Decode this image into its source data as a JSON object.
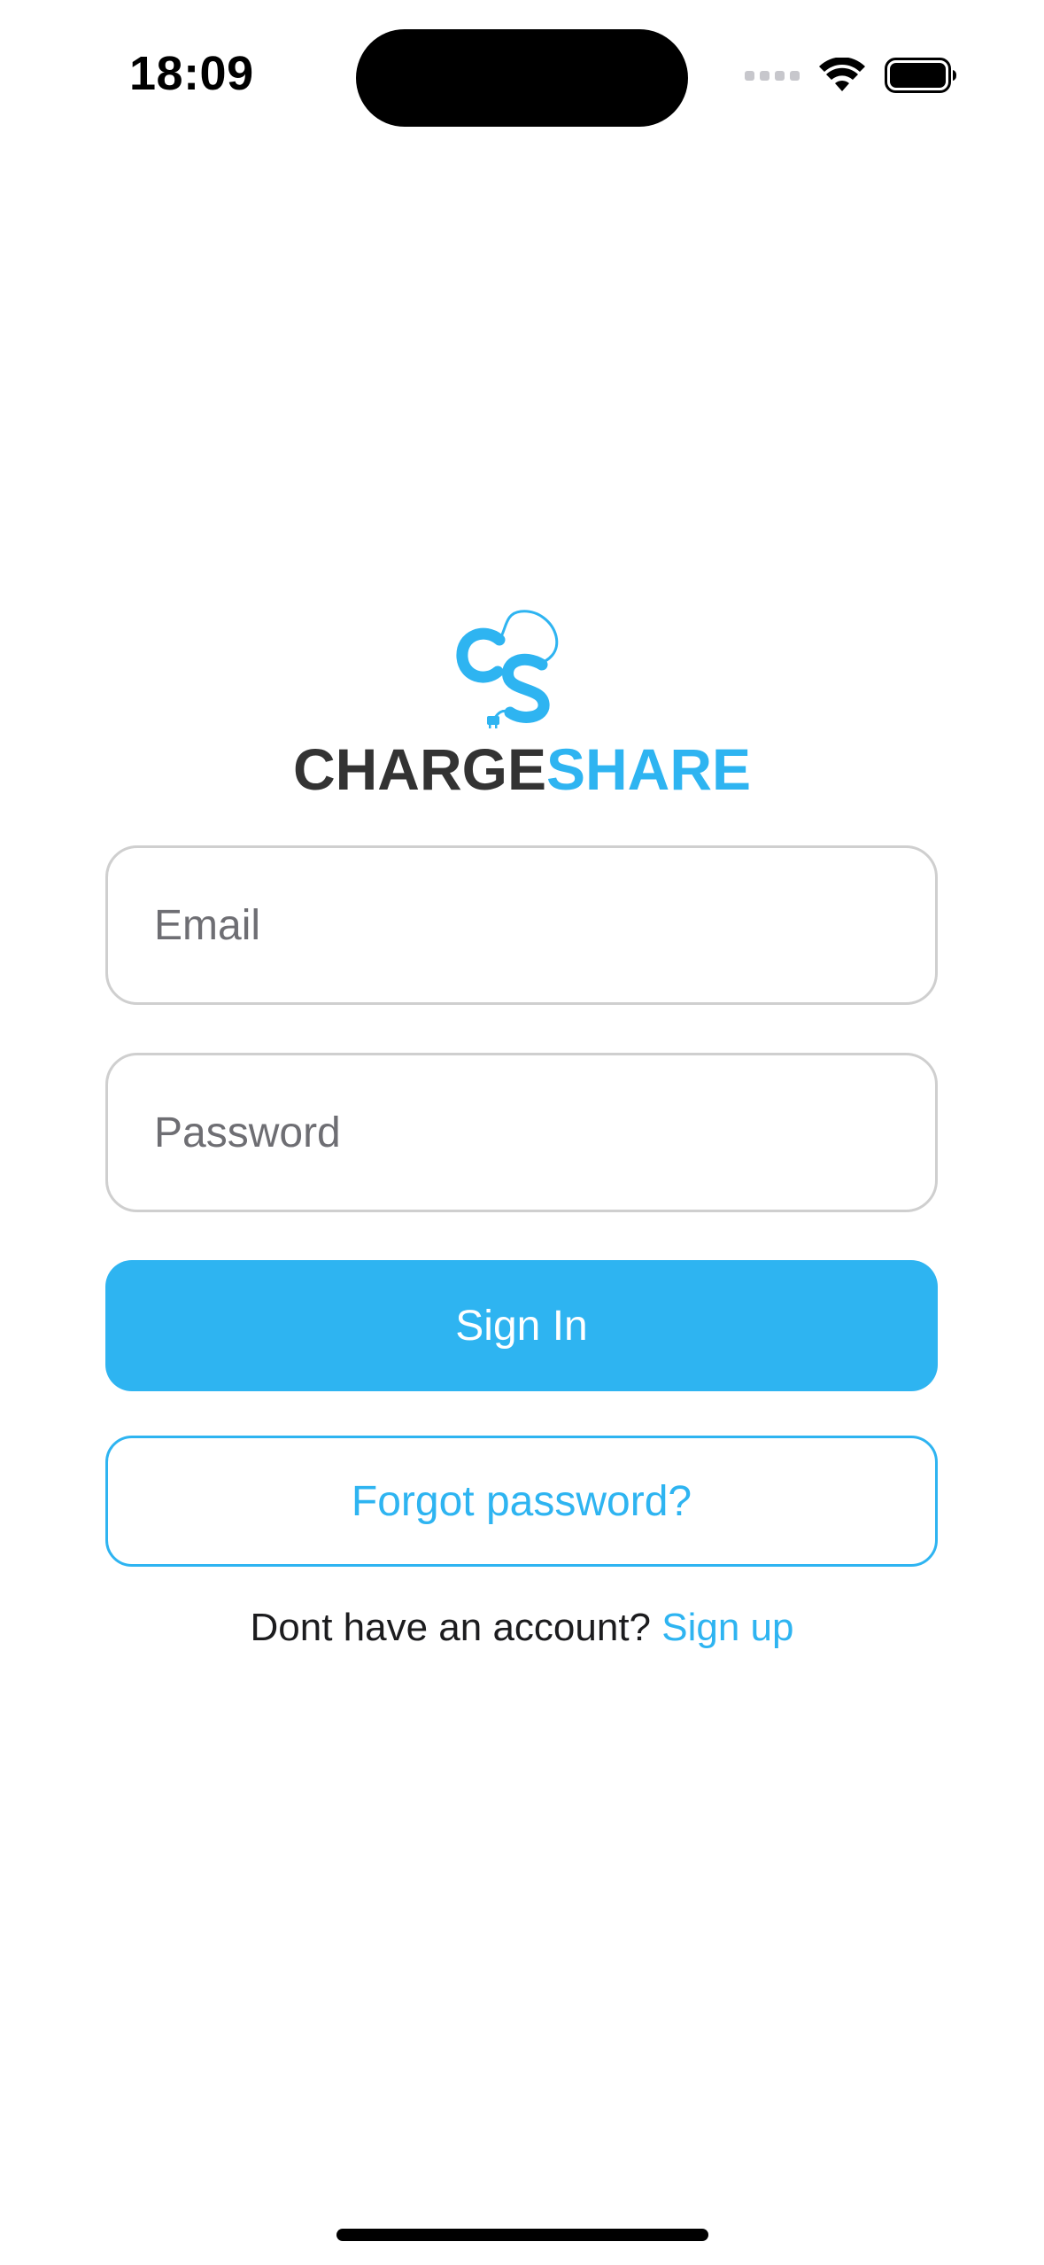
{
  "status_bar": {
    "time": "18:09"
  },
  "brand": {
    "part1": "CHARGE",
    "part2": "SHARE",
    "accent_color": "#2eb4f1",
    "dark_color": "#333333"
  },
  "form": {
    "email": {
      "placeholder": "Email",
      "value": ""
    },
    "password": {
      "placeholder": "Password",
      "value": ""
    },
    "sign_in_label": "Sign In",
    "forgot_password_label": "Forgot password?"
  },
  "signup": {
    "prompt": "Dont have an account?",
    "link_label": "Sign up"
  },
  "icons": {
    "logo": "chargeshare-cable-logo-icon",
    "wifi": "wifi-icon",
    "battery": "battery-icon",
    "signal": "cellular-signal-icon"
  }
}
